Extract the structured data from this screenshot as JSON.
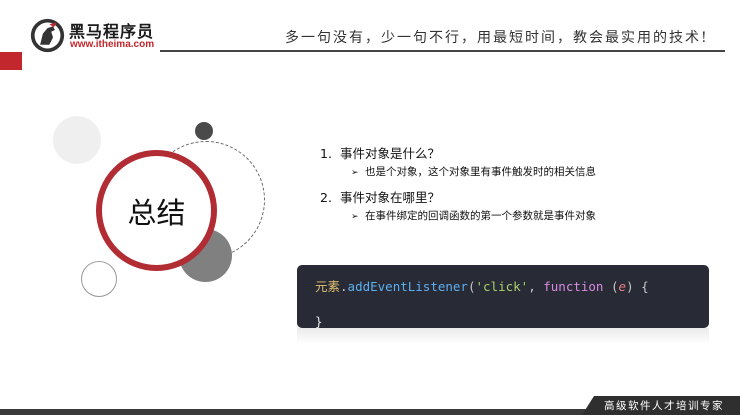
{
  "header": {
    "brand_name": "黑马程序员",
    "brand_url": "www.itheima.com",
    "slogan": "多一句没有，少一句不行，用最短时间，教会最实用的技术!"
  },
  "badge": {
    "title": "总结"
  },
  "content": {
    "items": [
      {
        "number": "1.",
        "question": "事件对象是什么？",
        "answer": "也是个对象，这个对象里有事件触发时的相关信息"
      },
      {
        "number": "2.",
        "question": "事件对象在哪里？",
        "answer": "在事件绑定的回调函数的第一个参数就是事件对象"
      }
    ],
    "bullet_icon": "arrow-right-icon"
  },
  "code": {
    "line1": {
      "object": "元素",
      "dot": ".",
      "method": "addEventListener",
      "open_paren": "(",
      "event_string": "'click'",
      "comma": ", ",
      "keyword": "function",
      "param_open": " (",
      "param": "e",
      "param_close": ") {"
    },
    "line2": "}"
  },
  "footer": {
    "tagline": "高级软件人才培训专家"
  },
  "colors": {
    "brand_red": "#c1272d",
    "badge_ring": "#b12c33",
    "code_background": "#282a36"
  }
}
